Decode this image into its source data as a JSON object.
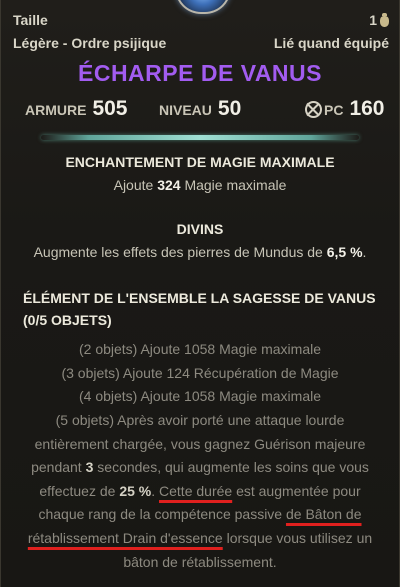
{
  "item": {
    "type": "Taille",
    "count": "1",
    "weight_quality": "Légère - Ordre psijique",
    "bind": "Lié quand équipé",
    "name": "ÉCHARPE DE VANUS",
    "name_color": "#a25cf0"
  },
  "stats": {
    "armure_label": "ARMURE",
    "armure_value": "505",
    "niveau_label": "NIVEAU",
    "niveau_value": "50",
    "pc_label": "PC",
    "pc_value": "160"
  },
  "enchant": {
    "title": "ENCHANTEMENT DE MAGIE MAXIMALE",
    "pre": "Ajoute ",
    "value": "324",
    "post": " Magie maximale"
  },
  "trait": {
    "title": "DIVINS",
    "pre": "Augmente les effets des pierres de Mundus de ",
    "value": "6,5 %",
    "post": "."
  },
  "set": {
    "title": "ÉLÉMENT DE L'ENSEMBLE LA SAGESSE DE VANUS (0/5 OBJETS)",
    "bonus_2": "(2 objets) Ajoute 1058 Magie maximale",
    "bonus_3": "(3 objets) Ajoute 124 Récupération de Magie",
    "bonus_4": "(4 objets) Ajoute 1058 Magie maximale",
    "bonus_5_a": "(5 objets) Après avoir porté une attaque lourde entièrement chargée, vous gagnez Guérison majeure pendant ",
    "bonus_5_num1": "3",
    "bonus_5_b": " secondes, qui augmente les soins que vous effectuez de ",
    "bonus_5_num2": "25 %",
    "bonus_5_c": ". ",
    "bonus_5_u1": "Cette durée",
    "bonus_5_d": " est augmentée pour chaque rang de la compétence passive ",
    "bonus_5_u2": "de Bâton de rétablissement Drain d'essence",
    "bonus_5_e": " lorsque vous utilisez un bâton de rétablissement."
  },
  "icons": {
    "top": "blue-gem-ornament-icon",
    "count": "bag-icon",
    "pc": "crossed-circle-icon"
  },
  "colors": {
    "annotation_underline": "#e0201e",
    "divider": "#9fe0d3"
  }
}
